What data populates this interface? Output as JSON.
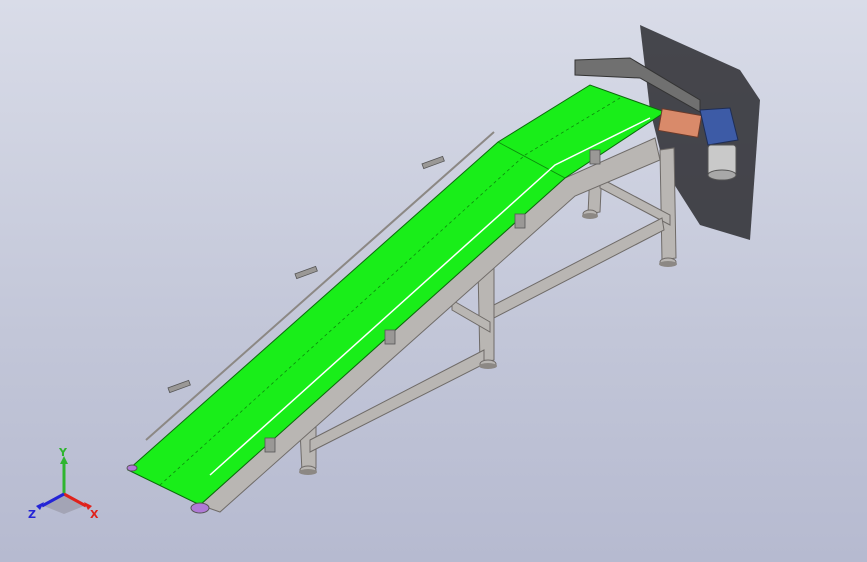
{
  "triad": {
    "x_label": "X",
    "y_label": "Y",
    "z_label": "Z",
    "x_color": "#e0221b",
    "y_color": "#2fb52f",
    "z_color": "#2424d6"
  },
  "colors": {
    "belt": "#19ee19",
    "frame": "#b9b6b3",
    "frame_dark": "#8c8884",
    "motor": "#3d5ba6",
    "guard_shadow": "#2b2b30"
  }
}
